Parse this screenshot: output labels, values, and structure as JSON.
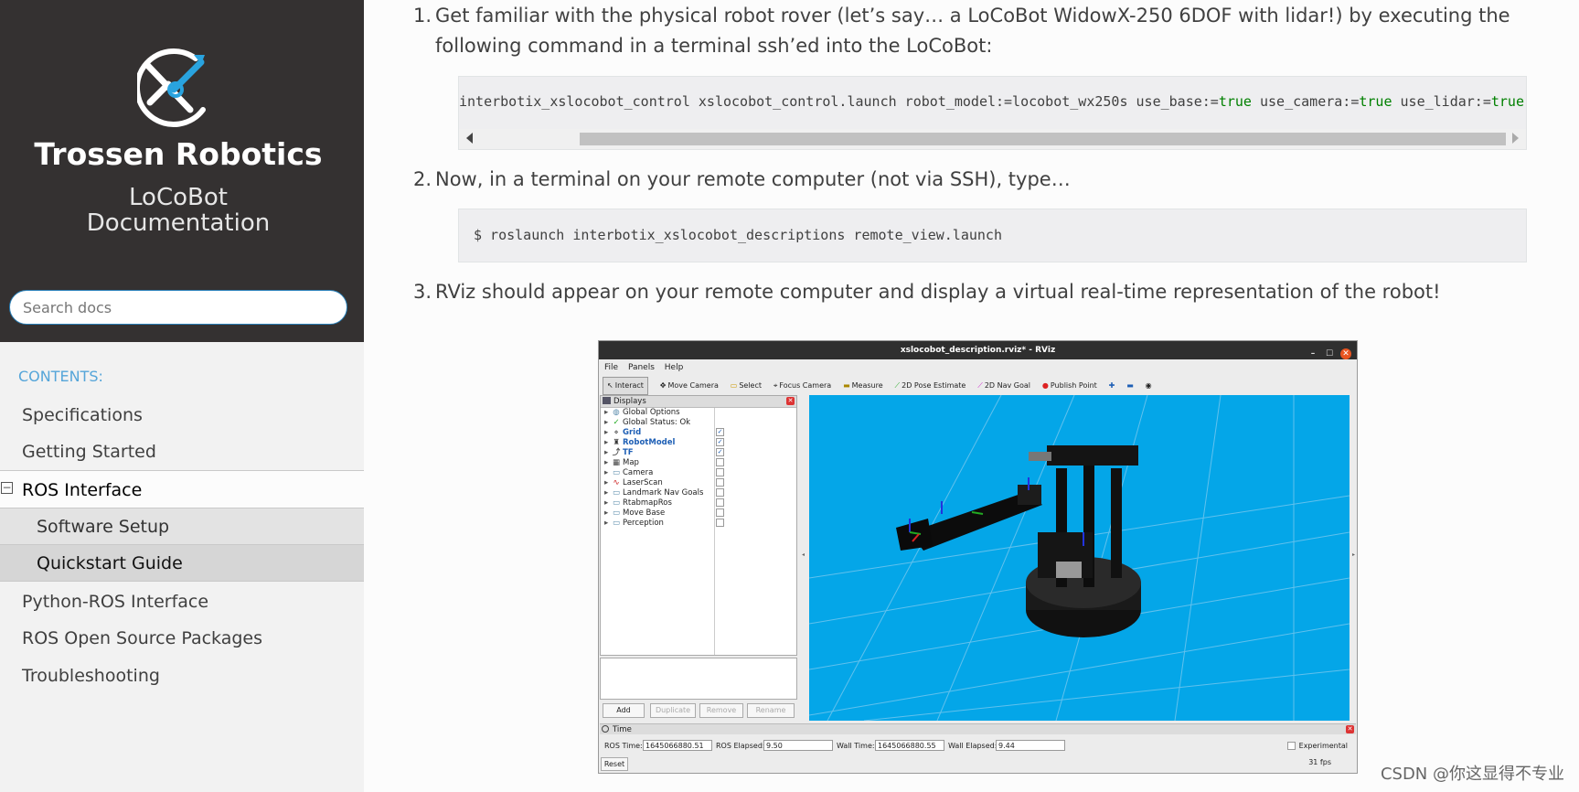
{
  "sidebar": {
    "brand_name": "Trossen Robotics",
    "brand_sub_line1": "LoCoBot",
    "brand_sub_line2": "Documentation",
    "search_placeholder": "Search docs",
    "contents_caption": "CONTENTS:",
    "items": [
      {
        "label": "Specifications"
      },
      {
        "label": "Getting Started"
      },
      {
        "label": "ROS Interface",
        "toggle": "−"
      },
      {
        "label": "Software Setup"
      },
      {
        "label": "Quickstart Guide"
      },
      {
        "label": "Python-ROS Interface"
      },
      {
        "label": "ROS Open Source Packages"
      },
      {
        "label": "Troubleshooting"
      }
    ]
  },
  "content": {
    "steps": [
      {
        "num": "1.",
        "text_line1": "Get familiar with the physical robot rover (let’s say… a LoCoBot WidowX-250 6DOF with lidar!) by executing the",
        "text_line2": "following command in a terminal ssh’ed into the LoCoBot:"
      },
      {
        "num": "2.",
        "text_line1": "Now, in a terminal on your remote computer (not via SSH), type…"
      },
      {
        "num": "3.",
        "text_line1": "RViz should appear on your remote computer and display a virtual real-time representation of the robot!"
      }
    ],
    "code1": {
      "p1": "interbotix_xslocobot_control xslocobot_control.launch robot_model:=locobot_wx250s use_base:=",
      "kw1": "true",
      "p2": " use_camera:=",
      "kw2": "true",
      "p3": " use_lidar:=",
      "kw3": "true"
    },
    "code2": "$ roslaunch interbotix_xslocobot_descriptions remote_view.launch"
  },
  "rviz": {
    "title": "xslocobot_description.rviz* - RViz",
    "win_buttons": [
      "–",
      "☐",
      "✕"
    ],
    "menu": [
      "File",
      "Panels",
      "Help"
    ],
    "tools": [
      {
        "label": "Interact",
        "icon": "interact-icon"
      },
      {
        "label": "Move Camera",
        "icon": "move-camera-icon"
      },
      {
        "label": "Select",
        "icon": "select-icon"
      },
      {
        "label": "Focus Camera",
        "icon": "focus-camera-icon"
      },
      {
        "label": "Measure",
        "icon": "measure-icon"
      },
      {
        "label": "2D Pose Estimate",
        "icon": "pose-estimate-icon"
      },
      {
        "label": "2D Nav Goal",
        "icon": "nav-goal-icon"
      },
      {
        "label": "Publish Point",
        "icon": "publish-point-icon"
      }
    ],
    "displays_title": "Displays",
    "displays": [
      {
        "label": "Global Options",
        "checked": null
      },
      {
        "label": "Global Status: Ok",
        "checked": null
      },
      {
        "label": "Grid",
        "checked": true
      },
      {
        "label": "RobotModel",
        "checked": true
      },
      {
        "label": "TF",
        "checked": true
      },
      {
        "label": "Map",
        "checked": false
      },
      {
        "label": "Camera",
        "checked": false
      },
      {
        "label": "LaserScan",
        "checked": false
      },
      {
        "label": "Landmark Nav Goals",
        "checked": false
      },
      {
        "label": "RtabmapRos",
        "checked": false
      },
      {
        "label": "Move Base",
        "checked": false
      },
      {
        "label": "Perception",
        "checked": false
      }
    ],
    "buttons": [
      "Add",
      "Duplicate",
      "Remove",
      "Rename"
    ],
    "time_title": "Time",
    "ros_time_label": "ROS Time:",
    "ros_time": "1645066880.51",
    "ros_elapsed_label": "ROS Elapsed:",
    "ros_elapsed": "9.50",
    "wall_time_label": "Wall Time:",
    "wall_time": "1645066880.55",
    "wall_elapsed_label": "Wall Elapsed:",
    "wall_elapsed": "9.44",
    "experimental_label": "Experimental",
    "reset_label": "Reset",
    "fps": "31 fps",
    "viewport_color": "#04a6e8"
  },
  "watermark": "CSDN @你这显得不专业",
  "colors": {
    "sidebar_dark": "#343131",
    "accent": "#2980b9",
    "caption": "#55a5d9",
    "keyword": "#008000"
  }
}
